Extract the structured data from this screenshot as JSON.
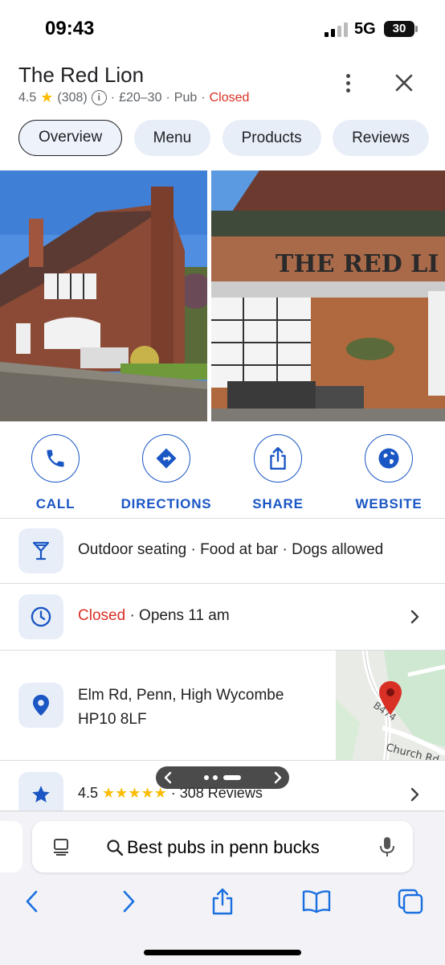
{
  "status_bar": {
    "time": "09:43",
    "network": "5G",
    "battery": "30"
  },
  "place": {
    "name": "The Red Lion",
    "rating": "4.5",
    "review_count": "(308)",
    "price": "£20–30",
    "category": "Pub",
    "status": "Closed",
    "separator": "·"
  },
  "tabs": [
    {
      "label": "Overview",
      "active": true
    },
    {
      "label": "Menu",
      "active": false
    },
    {
      "label": "Products",
      "active": false
    },
    {
      "label": "Reviews",
      "active": false
    }
  ],
  "photos": {
    "sign_text": "THE RED LI"
  },
  "actions": [
    {
      "label": "CALL",
      "icon": "phone-icon"
    },
    {
      "label": "DIRECTIONS",
      "icon": "directions-icon"
    },
    {
      "label": "SHARE",
      "icon": "share-icon"
    },
    {
      "label": "WEBSITE",
      "icon": "globe-icon"
    }
  ],
  "amenities": {
    "text": "Outdoor seating · Food at bar · Dogs allowed",
    "icon": "cocktail-icon"
  },
  "hours": {
    "status": "Closed",
    "detail": "· Opens 11 am",
    "icon": "clock-icon"
  },
  "address": {
    "line1": "Elm Rd, Penn, High Wycombe",
    "line2": "HP10 8LF",
    "icon": "location-pin-icon"
  },
  "map": {
    "road_label": "Church Rd",
    "road_code": "B474"
  },
  "rating_row": {
    "rating": "4.5",
    "stars": "★★★★★",
    "separator": "·",
    "reviews": "308 Reviews",
    "icon": "star-icon"
  },
  "browser": {
    "search_query": "Best pubs in penn bucks"
  },
  "colors": {
    "accent": "#1a56c4",
    "closed": "#d93025",
    "star": "#fbbc04",
    "chip_bg": "#e8eef8"
  }
}
